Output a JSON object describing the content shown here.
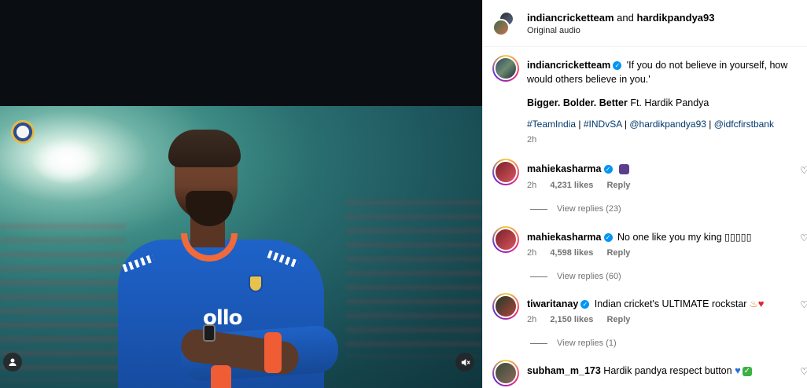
{
  "post": {
    "authors": {
      "first": "indiancricketteam",
      "joiner": "and",
      "second": "hardikpandya93"
    },
    "audio": "Original audio"
  },
  "caption": {
    "username": "indiancricketteam",
    "quote": "'If you do not believe in yourself, how would others believe in you.'",
    "headline_parts": [
      "Bigger.",
      "Bolder.",
      "Better"
    ],
    "headline_suffix": "Ft. Hardik Pandya",
    "hashtags": [
      "#TeamIndia",
      "#INDvSA",
      "@hardikpandya93",
      "@idfcfirstbank"
    ],
    "separator": "|",
    "time": "2h"
  },
  "comments": [
    {
      "username": "mahiekasharma",
      "text": "",
      "emoji": "purple-monster-emoji",
      "time": "2h",
      "likes": "4,231 likes",
      "reply": "Reply",
      "view_replies": "View replies (23)"
    },
    {
      "username": "mahiekasharma",
      "text": "No one like you my king ▯▯▯▯▯",
      "emoji": "",
      "time": "2h",
      "likes": "4,598 likes",
      "reply": "Reply",
      "view_replies": "View replies (60)"
    },
    {
      "username": "tiwaritanay",
      "text": "Indian cricket's ULTIMATE rockstar",
      "emoji": "fire-heart-emoji",
      "time": "2h",
      "likes": "2,150 likes",
      "reply": "Reply",
      "view_replies": "View replies (1)"
    },
    {
      "username": "subham_m_173",
      "text": "Hardik pandya respect button",
      "emoji": "blue-heart-check-emoji",
      "time": "",
      "likes": "",
      "reply": "",
      "view_replies": ""
    }
  ],
  "video": {
    "sponsor_text": "ollo"
  },
  "icons": {
    "verified": "verified-badge-icon",
    "heart": "heart-outline-icon",
    "mute": "muted-speaker-icon",
    "tagged_user": "user-icon"
  },
  "colors": {
    "link": "#00376b",
    "verified": "#0095f6",
    "meta": "#737373"
  }
}
